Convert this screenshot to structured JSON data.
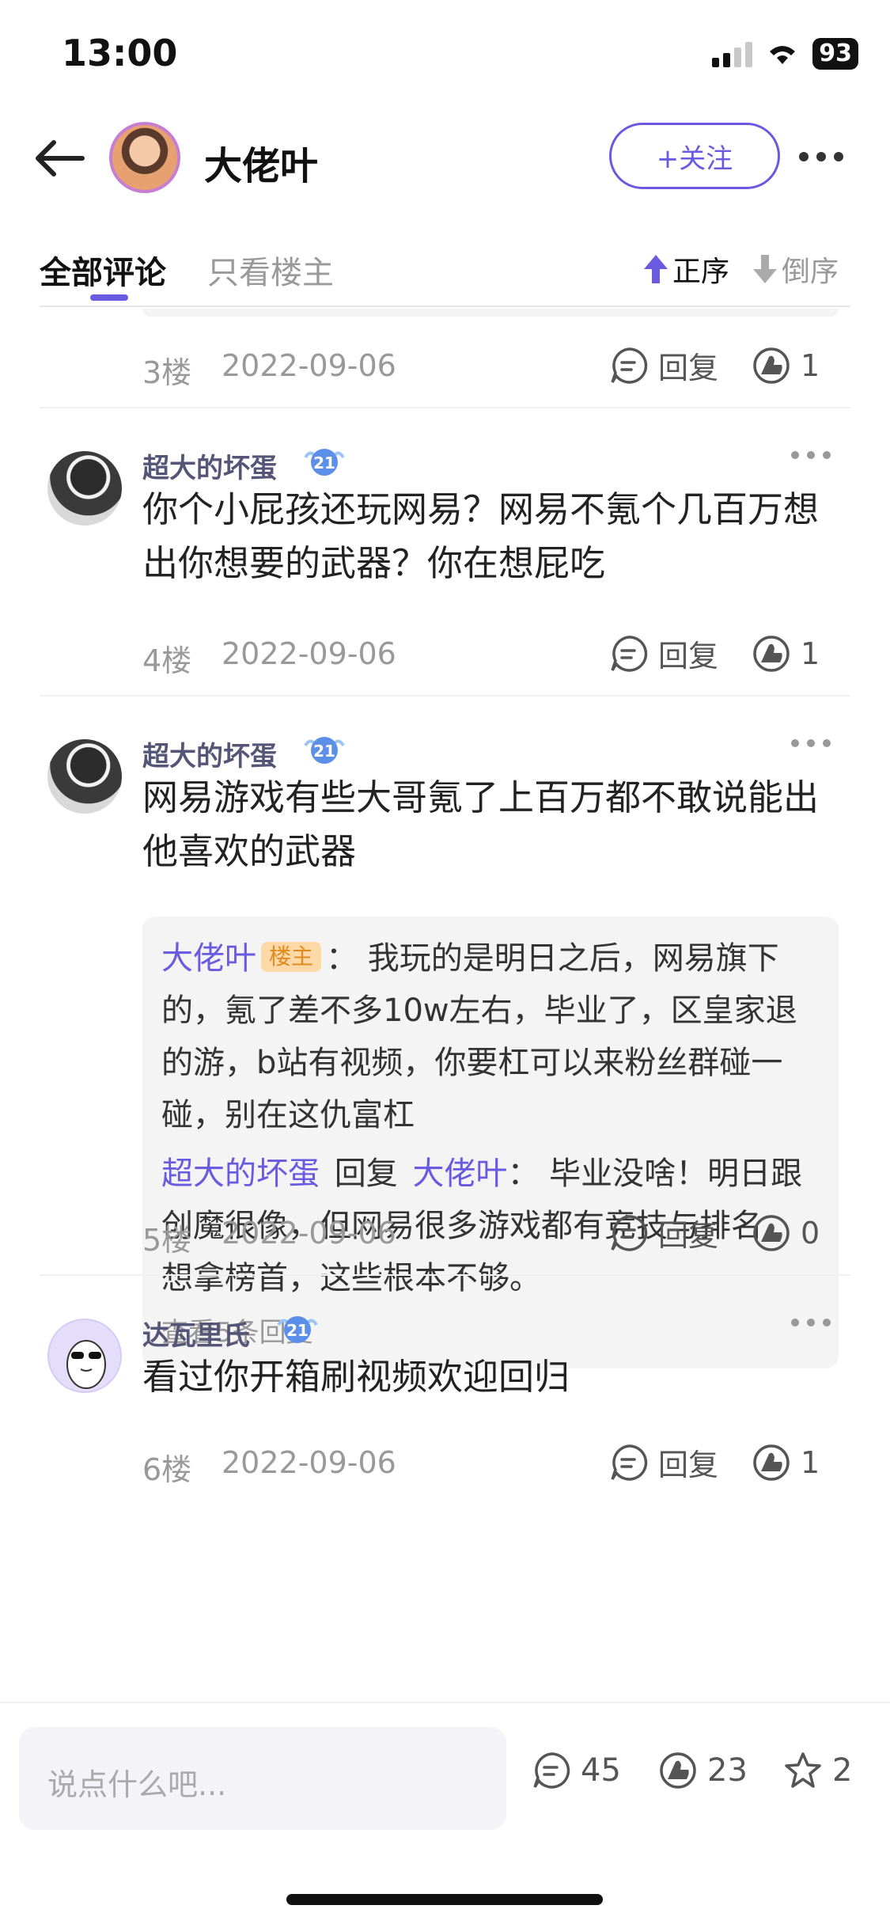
{
  "status_bar": {
    "time": "13:00",
    "battery": "93"
  },
  "header": {
    "user_name": "大佬叶",
    "follow_label": "+关注"
  },
  "tabs": {
    "all": "全部评论",
    "owner_only": "只看楼主"
  },
  "sort": {
    "asc": "正序",
    "desc": "倒序"
  },
  "reply_label": "回复",
  "comments": [
    {
      "floor": "3楼",
      "date": "2022-09-06",
      "likes": "1"
    },
    {
      "user": "超大的坏蛋",
      "level": "21",
      "text": "你个小屁孩还玩网易？网易不氪个几百万想出你想要的武器？你在想屁吃",
      "floor": "4楼",
      "date": "2022-09-06",
      "likes": "1"
    },
    {
      "user": "超大的坏蛋",
      "level": "21",
      "text": "网易游戏有些大哥氪了上百万都不敢说能出他喜欢的武器",
      "floor": "5楼",
      "date": "2022-09-06",
      "likes": "0",
      "sub_replies": {
        "first": {
          "name": "大佬叶",
          "tag": "楼主",
          "sep": "：",
          "text": "我玩的是明日之后，网易旗下的，氪了差不多10w左右，毕业了，区皇家退的游，b站有视频，你要杠可以来粉丝群碰一碰，别在这仇富杠"
        },
        "second": {
          "name": "超大的坏蛋",
          "reply_word": "回复",
          "target": "大佬叶",
          "sep": "：",
          "text": "毕业没啥！明日跟创魔很像，但网易很多游戏都有竞技与排名，想拿榜首，这些根本不够。"
        },
        "view_more": "查看5条回复"
      }
    },
    {
      "user": "达瓦里氏",
      "level": "21",
      "text": "看过你开箱刷视频欢迎回归",
      "floor": "6楼",
      "date": "2022-09-06",
      "likes": "1"
    }
  ],
  "bottom_bar": {
    "placeholder": "说点什么吧...",
    "comment_count": "45",
    "like_count": "23",
    "star_count": "2"
  }
}
